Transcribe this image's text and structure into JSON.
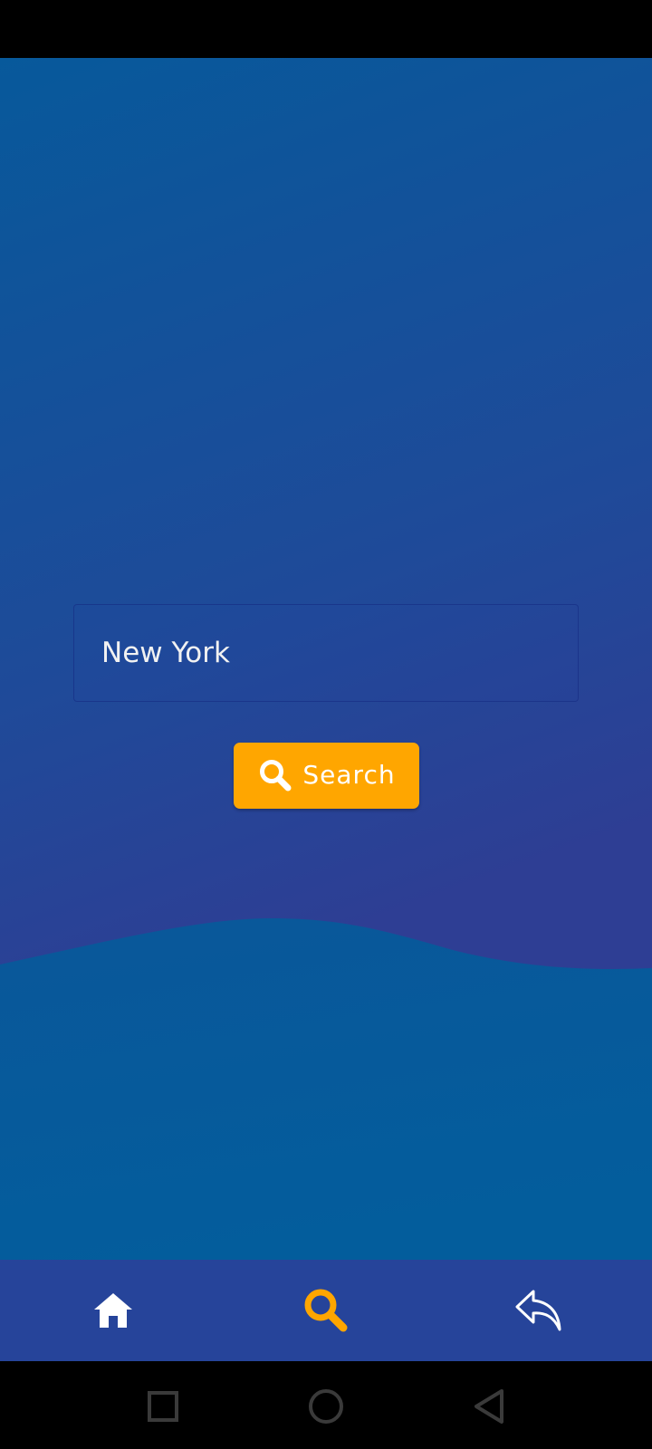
{
  "search": {
    "value": "New York",
    "button_label": "Search"
  },
  "bottom_nav": {
    "items": [
      {
        "icon": "home-icon",
        "active": false
      },
      {
        "icon": "search-icon",
        "active": true
      },
      {
        "icon": "reply-back-icon",
        "active": false
      }
    ]
  },
  "system_nav": {
    "items": [
      "recents-icon",
      "home-circle-icon",
      "back-triangle-icon"
    ]
  },
  "colors": {
    "accent": "#ffa600",
    "nav_background": "#26449a",
    "background_top": "#07599b",
    "background_bottom": "#2e3e94"
  }
}
